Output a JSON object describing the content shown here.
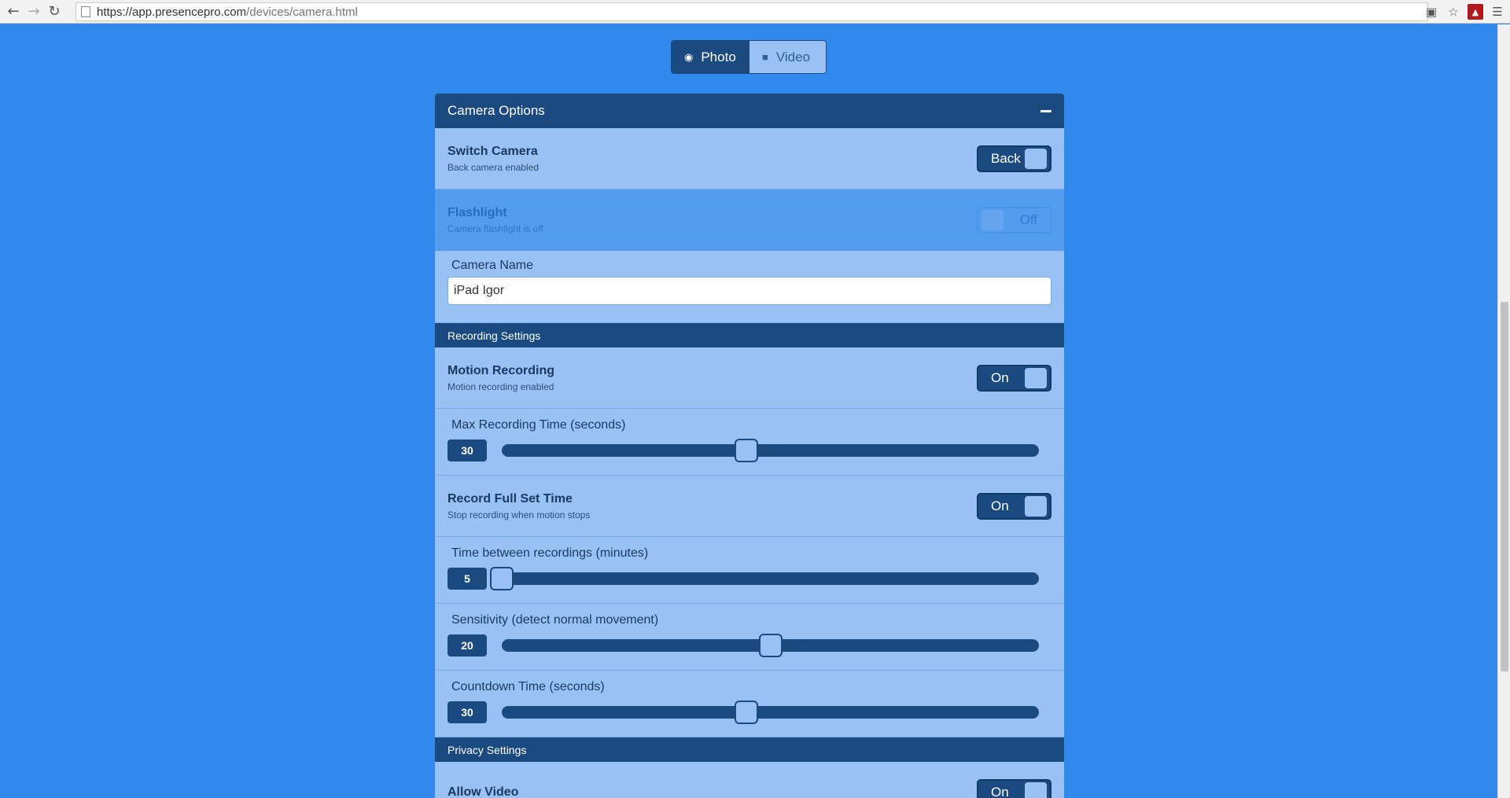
{
  "browser": {
    "url_host": "https://app.presencepro.com",
    "url_path": "/devices/camera.html"
  },
  "mode_toggle": {
    "photo_label": "Photo",
    "video_label": "Video",
    "selected": "Photo"
  },
  "camera_options": {
    "title": "Camera Options",
    "switch_camera": {
      "title": "Switch Camera",
      "subtitle": "Back camera enabled",
      "state": "Back"
    },
    "flashlight": {
      "title": "Flashlight",
      "subtitle": "Camera flashlight is off",
      "state": "Off"
    },
    "camera_name": {
      "label": "Camera Name",
      "value": "iPad Igor"
    }
  },
  "recording_settings": {
    "title": "Recording Settings",
    "motion_recording": {
      "title": "Motion Recording",
      "subtitle": "Motion recording enabled",
      "state": "On"
    },
    "max_recording_time": {
      "label": "Max Recording Time (seconds)",
      "value": "30",
      "fraction": 0.455
    },
    "record_full_set_time": {
      "title": "Record Full Set Time",
      "subtitle": "Stop recording when motion stops",
      "state": "On"
    },
    "time_between": {
      "label": "Time between recordings (minutes)",
      "value": "5",
      "fraction": 0.0
    },
    "sensitivity": {
      "label": "Sensitivity (detect normal movement)",
      "value": "20",
      "fraction": 0.5
    },
    "countdown_time": {
      "label": "Countdown Time (seconds)",
      "value": "30",
      "fraction": 0.455
    }
  },
  "privacy_settings": {
    "title": "Privacy Settings",
    "allow_video": {
      "title": "Allow Video",
      "state": "On"
    }
  }
}
